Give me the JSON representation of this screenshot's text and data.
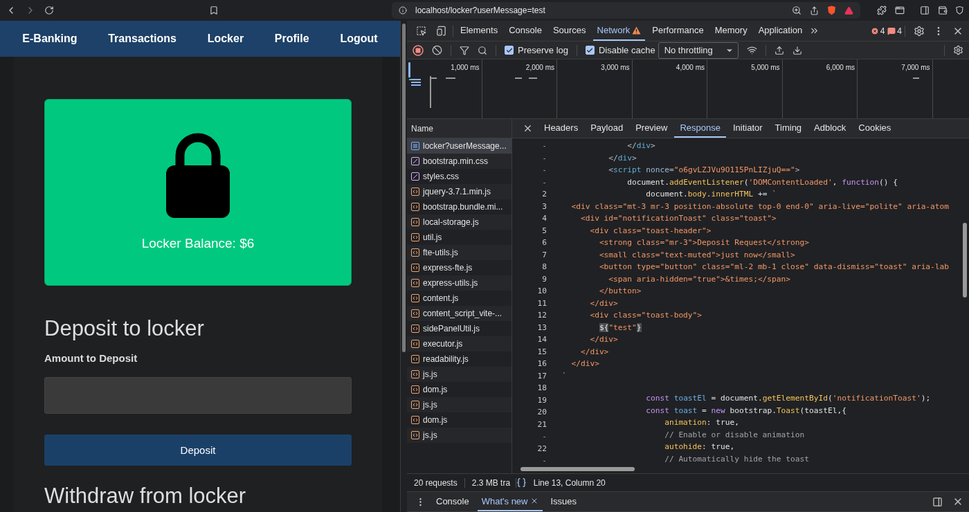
{
  "browser": {
    "url": "localhost/locker?userMessage=test"
  },
  "site": {
    "nav": [
      "E-Banking",
      "Transactions",
      "Locker",
      "Profile",
      "Logout"
    ],
    "balance": "Locker Balance: $6",
    "deposit_heading": "Deposit to locker",
    "amount_label": "Amount to Deposit",
    "deposit_button": "Deposit",
    "withdraw_heading": "Withdraw from locker"
  },
  "devtools": {
    "tabs": [
      {
        "label": "Elements",
        "selected": false,
        "warning": false
      },
      {
        "label": "Console",
        "selected": false,
        "warning": false
      },
      {
        "label": "Sources",
        "selected": false,
        "warning": false
      },
      {
        "label": "Network",
        "selected": true,
        "warning": true
      },
      {
        "label": "Performance",
        "selected": false,
        "warning": false
      },
      {
        "label": "Memory",
        "selected": false,
        "warning": false
      },
      {
        "label": "Application",
        "selected": false,
        "warning": false
      }
    ],
    "error_count": "4",
    "issue_count": "4",
    "toolbar": {
      "preserve_log": {
        "label": "Preserve log",
        "checked": true
      },
      "disable_cache": {
        "label": "Disable cache",
        "checked": true
      },
      "throttling": "No throttling"
    },
    "timeline_ticks": [
      "1,000 ms",
      "2,000 ms",
      "3,000 ms",
      "4,000 ms",
      "5,000 ms",
      "6,000 ms",
      "7,000 ms"
    ],
    "name_header": "Name",
    "requests": [
      {
        "name": "locker?userMessage...",
        "kind": "document",
        "selected": true
      },
      {
        "name": "bootstrap.min.css",
        "kind": "stylesheet",
        "selected": false
      },
      {
        "name": "styles.css",
        "kind": "stylesheet",
        "selected": false
      },
      {
        "name": "jquery-3.7.1.min.js",
        "kind": "script",
        "selected": false
      },
      {
        "name": "bootstrap.bundle.mi...",
        "kind": "script",
        "selected": false
      },
      {
        "name": "local-storage.js",
        "kind": "script",
        "selected": false
      },
      {
        "name": "util.js",
        "kind": "script",
        "selected": false
      },
      {
        "name": "fte-utils.js",
        "kind": "script",
        "selected": false
      },
      {
        "name": "express-fte.js",
        "kind": "script",
        "selected": false
      },
      {
        "name": "express-utils.js",
        "kind": "script",
        "selected": false
      },
      {
        "name": "content.js",
        "kind": "script",
        "selected": false
      },
      {
        "name": "content_script_vite-...",
        "kind": "script",
        "selected": false
      },
      {
        "name": "sidePanelUtil.js",
        "kind": "script",
        "selected": false
      },
      {
        "name": "executor.js",
        "kind": "script",
        "selected": false
      },
      {
        "name": "readability.js",
        "kind": "script",
        "selected": false
      },
      {
        "name": "js.js",
        "kind": "script",
        "selected": false
      },
      {
        "name": "dom.js",
        "kind": "script",
        "selected": false
      },
      {
        "name": "js.js",
        "kind": "script",
        "selected": false
      },
      {
        "name": "dom.js",
        "kind": "script",
        "selected": false
      },
      {
        "name": "js.js",
        "kind": "script",
        "selected": false
      }
    ],
    "detail_tabs": [
      {
        "label": "Headers",
        "selected": false
      },
      {
        "label": "Payload",
        "selected": false
      },
      {
        "label": "Preview",
        "selected": false
      },
      {
        "label": "Response",
        "selected": true
      },
      {
        "label": "Initiator",
        "selected": false
      },
      {
        "label": "Timing",
        "selected": false
      },
      {
        "label": "Adblock",
        "selected": false
      },
      {
        "label": "Cookies",
        "selected": false
      }
    ],
    "code": [
      {
        "num": "-",
        "segments": [
          {
            "kind": "punct",
            "text": "              </"
          },
          {
            "kind": "tag",
            "text": "div"
          },
          {
            "kind": "punct",
            "text": ">"
          }
        ]
      },
      {
        "num": "-",
        "segments": [
          {
            "kind": "punct",
            "text": "          </"
          },
          {
            "kind": "tag",
            "text": "div"
          },
          {
            "kind": "punct",
            "text": ">"
          }
        ]
      },
      {
        "num": "-",
        "segments": [
          {
            "kind": "punct",
            "text": "          <"
          },
          {
            "kind": "tag",
            "text": "script"
          },
          {
            "kind": "attr",
            "text": " nonce"
          },
          {
            "kind": "punct",
            "text": "="
          },
          {
            "kind": "string",
            "text": "\"o6gvLZJVu9O115PnLIZjuQ==\""
          },
          {
            "kind": "punct",
            "text": ">"
          }
        ]
      },
      {
        "num": "-",
        "segments": [
          {
            "kind": "plain",
            "text": "              document."
          },
          {
            "kind": "method",
            "text": "addEventListener"
          },
          {
            "kind": "plain",
            "text": "("
          },
          {
            "kind": "string",
            "text": "'DOMContentLoaded'"
          },
          {
            "kind": "plain",
            "text": ", "
          },
          {
            "kind": "keyword",
            "text": "function"
          },
          {
            "kind": "plain",
            "text": "() {"
          }
        ]
      },
      {
        "num": "2",
        "segments": [
          {
            "kind": "plain",
            "text": "                  document."
          },
          {
            "kind": "method",
            "text": "body"
          },
          {
            "kind": "plain",
            "text": "."
          },
          {
            "kind": "method",
            "text": "innerHTML"
          },
          {
            "kind": "plain",
            "text": " += "
          },
          {
            "kind": "string",
            "text": "`"
          }
        ]
      },
      {
        "num": "3",
        "segments": [
          {
            "kind": "string",
            "text": "  <div class=\"mt-3 mr-3 position-absolute top-0 end-0\" aria-live=\"polite\" aria-atom"
          }
        ]
      },
      {
        "num": "4",
        "segments": [
          {
            "kind": "string",
            "text": "    <div id=\"notificationToast\" class=\"toast\">"
          }
        ]
      },
      {
        "num": "5",
        "segments": [
          {
            "kind": "string",
            "text": "      <div class=\"toast-header\">"
          }
        ]
      },
      {
        "num": "6",
        "segments": [
          {
            "kind": "string",
            "text": "        <strong class=\"mr-3\">Deposit Request</strong>"
          }
        ]
      },
      {
        "num": "7",
        "segments": [
          {
            "kind": "string",
            "text": "        <small class=\"text-muted\">just now</small>"
          }
        ]
      },
      {
        "num": "8",
        "segments": [
          {
            "kind": "string",
            "text": "        <button type=\"button\" class=\"ml-2 mb-1 close\" data-dismiss=\"toast\" aria-lab"
          }
        ]
      },
      {
        "num": "9",
        "segments": [
          {
            "kind": "string",
            "text": "          <span aria-hidden=\"true\">&times;</span>"
          }
        ]
      },
      {
        "num": "10",
        "segments": [
          {
            "kind": "string",
            "text": "        </button>"
          }
        ]
      },
      {
        "num": "11",
        "segments": [
          {
            "kind": "string",
            "text": "      </div>"
          }
        ]
      },
      {
        "num": "12",
        "segments": [
          {
            "kind": "string",
            "text": "      <div class=\"toast-body\">"
          }
        ]
      },
      {
        "num": "13",
        "segments": [
          {
            "kind": "match",
            "text": "        ${"
          },
          {
            "kind": "string",
            "text": "\"test\""
          },
          {
            "kind": "match",
            "text": "}"
          }
        ]
      },
      {
        "num": "14",
        "segments": [
          {
            "kind": "string",
            "text": "      </div>"
          }
        ]
      },
      {
        "num": "15",
        "segments": [
          {
            "kind": "string",
            "text": "    </div>"
          }
        ]
      },
      {
        "num": "16",
        "segments": [
          {
            "kind": "string",
            "text": "  </div>"
          }
        ]
      },
      {
        "num": "17",
        "segments": [
          {
            "kind": "string",
            "text": "`"
          }
        ]
      },
      {
        "num": "18"
      },
      {
        "num": "19",
        "segments": [
          {
            "kind": "keyword",
            "text": "                  const "
          },
          {
            "kind": "ident",
            "text": "toastEl"
          },
          {
            "kind": "plain",
            "text": " = document."
          },
          {
            "kind": "method",
            "text": "getElementById"
          },
          {
            "kind": "plain",
            "text": "("
          },
          {
            "kind": "string",
            "text": "'notificationToast'"
          },
          {
            "kind": "plain",
            "text": ");"
          }
        ]
      },
      {
        "num": "20",
        "segments": [
          {
            "kind": "keyword",
            "text": "                  const "
          },
          {
            "kind": "ident",
            "text": "toast"
          },
          {
            "kind": "plain",
            "text": " = "
          },
          {
            "kind": "keyword",
            "text": "new"
          },
          {
            "kind": "plain",
            "text": " bootstrap."
          },
          {
            "kind": "method",
            "text": "Toast"
          },
          {
            "kind": "plain",
            "text": "(toastEl,{"
          }
        ]
      },
      {
        "num": "21",
        "segments": [
          {
            "kind": "prop",
            "text": "                      animation"
          },
          {
            "kind": "plain",
            "text": ": true,"
          }
        ]
      },
      {
        "num": "-",
        "segments": [
          {
            "kind": "comment",
            "text": "                      // Enable or disable animation"
          }
        ]
      },
      {
        "num": "22",
        "segments": [
          {
            "kind": "prop",
            "text": "                      autohide"
          },
          {
            "kind": "plain",
            "text": ": true,"
          }
        ]
      },
      {
        "num": "-",
        "segments": [
          {
            "kind": "comment",
            "text": "                      // Automatically hide the toast"
          }
        ]
      }
    ],
    "status": {
      "requests": "20 requests",
      "transferred": "2.3 MB tra",
      "position": "Line 13, Column 20"
    },
    "drawer_tabs": [
      {
        "label": "Console",
        "selected": false,
        "closable": false
      },
      {
        "label": "What's new",
        "selected": true,
        "closable": true
      },
      {
        "label": "Issues",
        "selected": false,
        "closable": false
      }
    ]
  }
}
